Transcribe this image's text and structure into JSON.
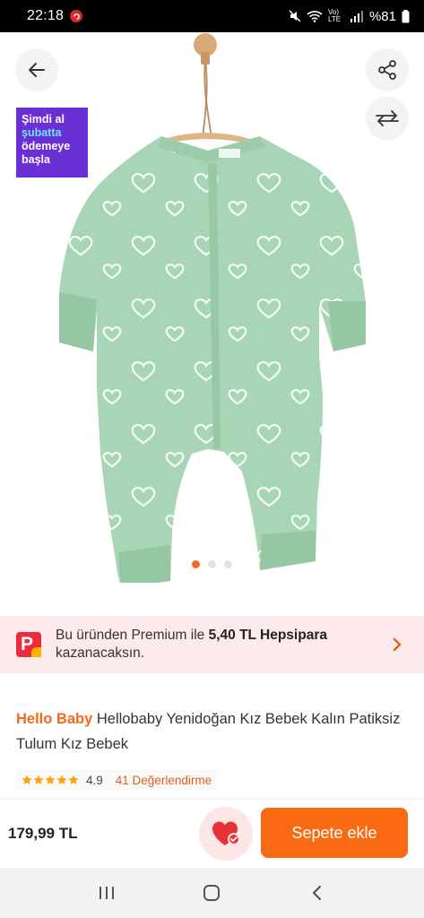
{
  "status_bar": {
    "time": "22:18",
    "notification_badge": "",
    "network": "Vo) LTE",
    "battery": "%81"
  },
  "product_image": {
    "promo_badge": {
      "line1": "Şimdi al",
      "line2": "şubatta",
      "line3": "ödemeye",
      "line4": "başla"
    },
    "carousel": {
      "current": 1,
      "total": 3
    },
    "colors": {
      "garment": "#a8d5b5",
      "print": "#ffffff",
      "hanger": "#d9a878"
    }
  },
  "hepsipara": {
    "text_before": "Bu üründen Premium ile ",
    "amount": "5,40 TL Hepsipara",
    "text_after": " kazanacaksın."
  },
  "product": {
    "brand": "Hello Baby",
    "name": " Hellobaby Yenidoğan Kız Bebek Kalın Patiksiz Tulum Kız Bebek",
    "rating": "4.9",
    "stars": 5,
    "review_count": "41 Değerlendirme"
  },
  "purchase": {
    "price": "179,99 TL",
    "add_to_cart": "Sepete ekle"
  },
  "accent_colors": {
    "orange": "#fa6a12",
    "promo_purple": "#6b2fd6",
    "favorite_red": "#e8323a"
  }
}
